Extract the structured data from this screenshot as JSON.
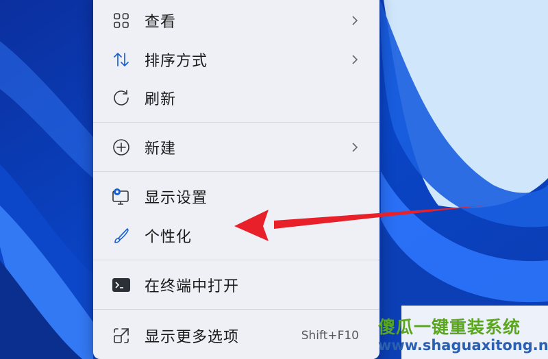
{
  "context_menu": {
    "items": [
      {
        "label": "查看",
        "icon": "grid-view-icon",
        "submenu": true
      },
      {
        "label": "排序方式",
        "icon": "sort-arrows-icon",
        "submenu": true
      },
      {
        "label": "刷新",
        "icon": "refresh-icon",
        "submenu": false
      },
      {
        "label": "新建",
        "icon": "plus-circle-icon",
        "submenu": true
      },
      {
        "label": "显示设置",
        "icon": "display-settings-icon",
        "submenu": false
      },
      {
        "label": "个性化",
        "icon": "brush-icon",
        "submenu": false
      },
      {
        "label": "在终端中打开",
        "icon": "terminal-icon",
        "submenu": false
      },
      {
        "label": "显示更多选项",
        "icon": "more-options-icon",
        "submenu": false,
        "shortcut": "Shift+F10"
      }
    ]
  },
  "annotation": {
    "arrow_color": "#e8202a",
    "points_to": "个性化"
  },
  "watermark": {
    "title": "傻瓜一键重装系统",
    "url": "www.shaguaxitong.net"
  },
  "colors": {
    "menu_bg": "#eef0f6",
    "wallpaper_blue": "#0a3fb8",
    "accent": "#1a5fd0"
  }
}
